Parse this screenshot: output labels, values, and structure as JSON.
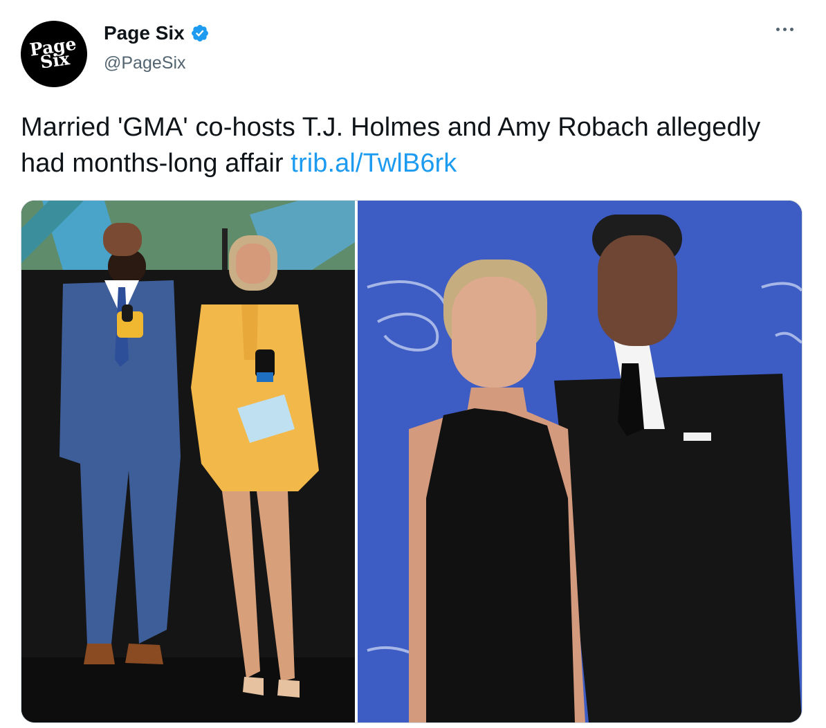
{
  "tweet": {
    "author": {
      "display_name": "Page Six",
      "handle": "@PageSix",
      "avatar_line1": "Page",
      "avatar_line2": "Six",
      "verified": true,
      "verified_color": "#1d9bf0"
    },
    "text": "Married 'GMA' co-hosts T.J. Holmes and Amy Robach allegedly had months-long affair",
    "link": "trib.al/TwlB6rk",
    "more_icon": "more-horizontal-icon",
    "media": {
      "left_photo": "two co-hosts on stage, man in blue suit and woman in yellow suit holding microphones",
      "right_photo": "couple posing in black outfits in front of blue Disney backdrop"
    }
  },
  "colors": {
    "link": "#1d9bf0",
    "text": "#0f1419",
    "secondary": "#536471"
  }
}
